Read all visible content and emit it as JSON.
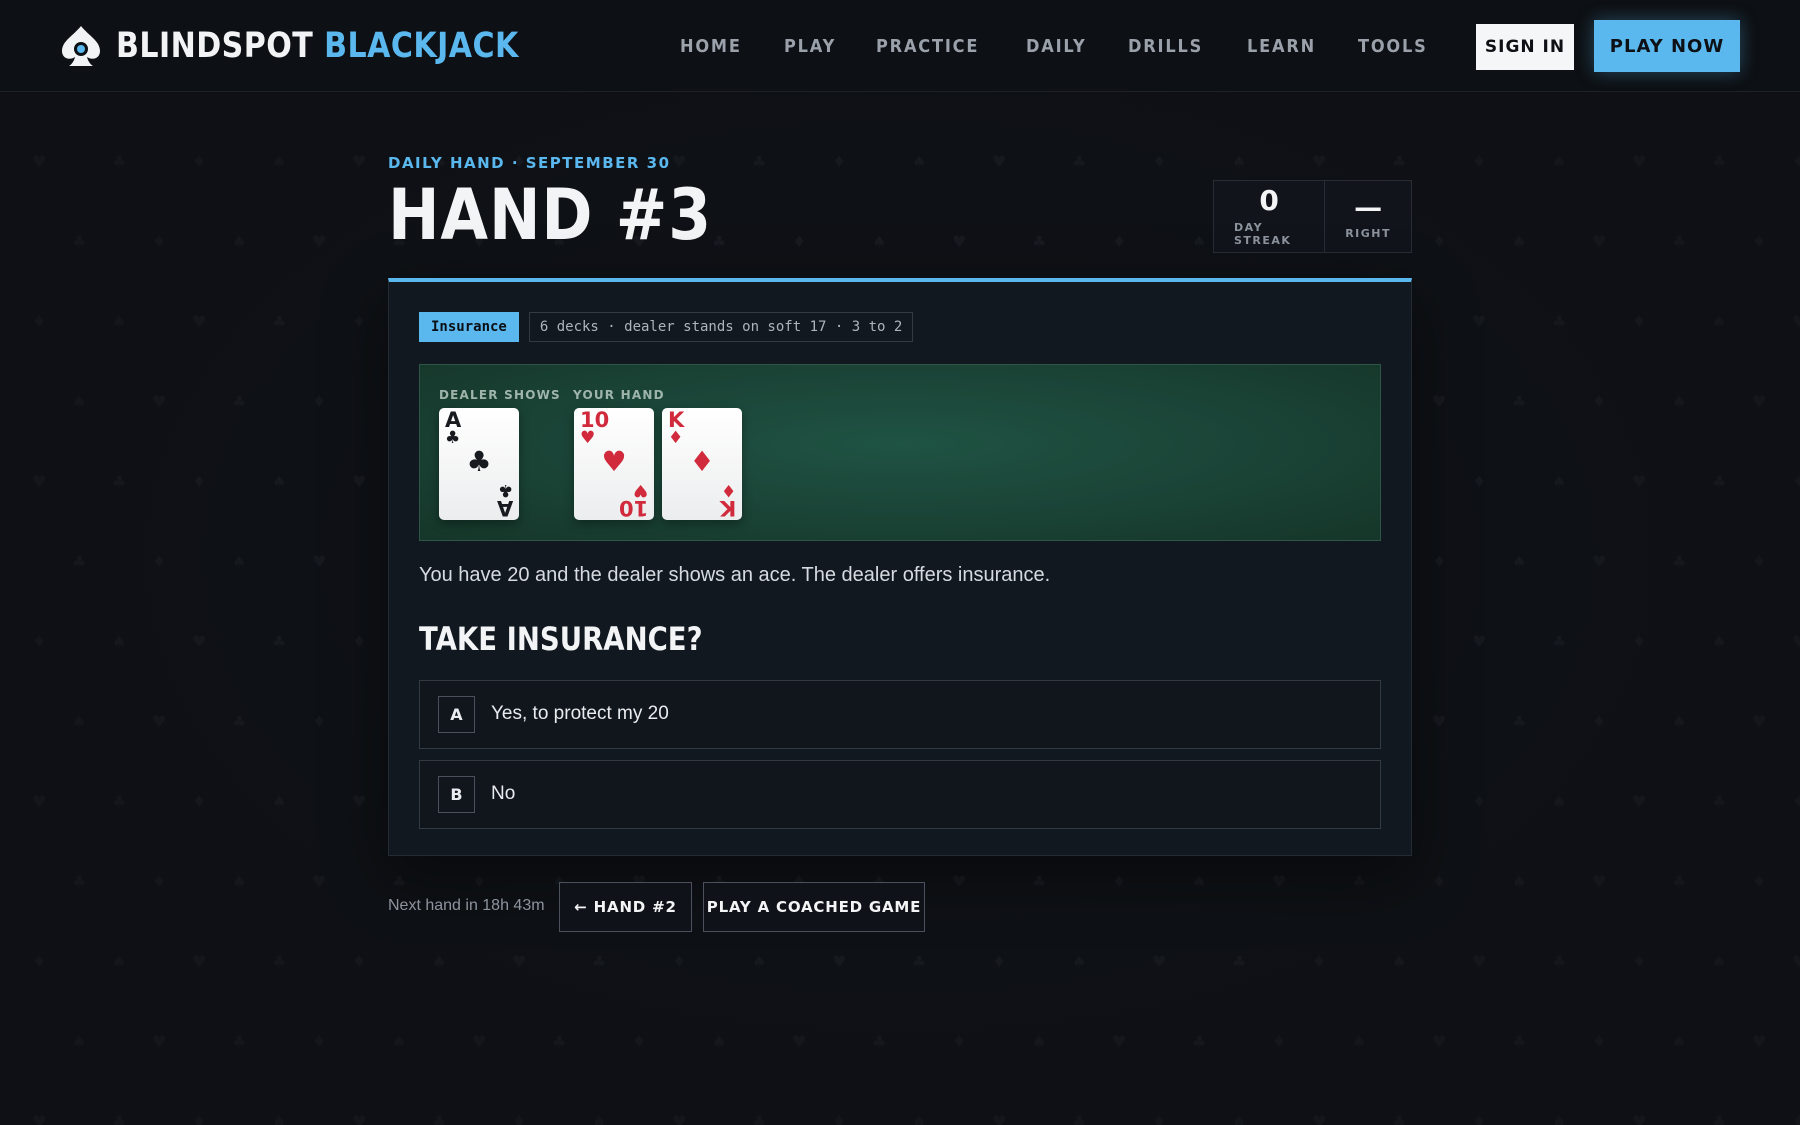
{
  "brand": {
    "name_part1": "BLINDSPOT",
    "name_part2": "BLACKJACK",
    "accent_color": "#5ab8ee"
  },
  "nav": [
    {
      "label": "HOME"
    },
    {
      "label": "PLAY"
    },
    {
      "label": "PRACTICE"
    },
    {
      "label": "DAILY"
    },
    {
      "label": "DRILLS"
    },
    {
      "label": "LEARN"
    },
    {
      "label": "TOOLS"
    }
  ],
  "header_actions": {
    "sign_in": "SIGN IN",
    "play_now": "PLAY NOW"
  },
  "daily": {
    "eyebrow": "DAILY HAND · SEPTEMBER 30",
    "title": "HAND #3",
    "stats": [
      {
        "value": "0",
        "label": "DAY STREAK"
      },
      {
        "value": "—",
        "label": "RIGHT"
      }
    ]
  },
  "puzzle": {
    "tag": "Insurance",
    "rules": "6 decks · dealer stands on soft 17 · 3 to 2",
    "dealer_label": "DEALER SHOWS",
    "player_label": "YOUR HAND",
    "dealer_cards": [
      {
        "rank": "A",
        "suit": "♣",
        "suit_name": "club-icon",
        "color": "black"
      }
    ],
    "player_cards": [
      {
        "rank": "10",
        "suit": "♥",
        "suit_name": "heart-icon",
        "color": "red"
      },
      {
        "rank": "K",
        "suit": "♦",
        "suit_name": "diamond-icon",
        "color": "red"
      }
    ],
    "scenario": "You have 20 and the dealer shows an ace. The dealer offers insurance.",
    "question": "TAKE INSURANCE?",
    "options": [
      {
        "key": "A",
        "text": "Yes, to protect my 20"
      },
      {
        "key": "B",
        "text": "No"
      }
    ]
  },
  "footer": {
    "next_hand": "Next hand in 18h 43m",
    "prev_button": "← HAND #2",
    "coached_button": "PLAY A COACHED GAME"
  }
}
